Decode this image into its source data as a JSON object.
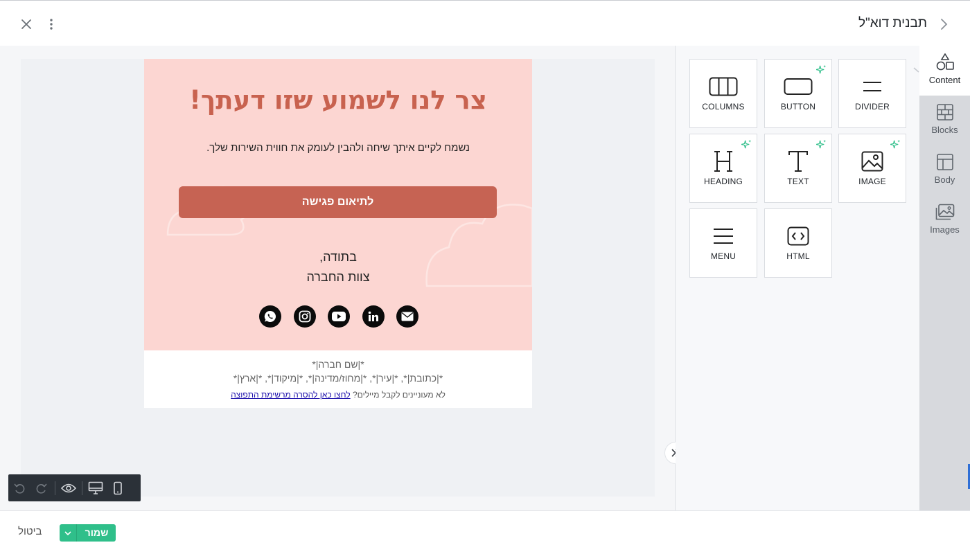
{
  "header": {
    "title": "תבנית דוא\"ל"
  },
  "email": {
    "headline": "צר לנו לשמוע שזו דעתך!",
    "subtext": "נשמח לקיים איתך שיחה ולהבין לעומק את חווית השירות שלך.",
    "cta_label": "לתיאום פגישה",
    "signature_line1": "בתודה,",
    "signature_line2": "צוות החברה",
    "social_icons": [
      "whatsapp-icon",
      "instagram-icon",
      "youtube-icon",
      "linkedin-icon",
      "email-icon"
    ],
    "footer_company": "*|שם חברה|*",
    "footer_address": "*|כתובת|*, *|עיר|*, *|מחוז/מדינה|*, *|מיקוד|*, *|ארץ|*",
    "footer_unsub_text": "לא מעוניינים לקבל מיילים?",
    "footer_unsub_link": "לחצו כאן להסרה מרשימת התפוצה"
  },
  "content_panel": {
    "tiles": [
      {
        "label": "COLUMNS",
        "icon": "columns-icon"
      },
      {
        "label": "BUTTON",
        "icon": "button-icon",
        "ai": true
      },
      {
        "label": "DIVIDER",
        "icon": "divider-icon"
      },
      {
        "label": "HEADING",
        "icon": "heading-icon",
        "ai": true
      },
      {
        "label": "TEXT",
        "icon": "text-icon",
        "ai": true
      },
      {
        "label": "IMAGE",
        "icon": "image-icon",
        "ai": true
      },
      {
        "label": "MENU",
        "icon": "menu-icon"
      },
      {
        "label": "HTML",
        "icon": "html-icon"
      }
    ]
  },
  "rail": {
    "items": [
      {
        "label": "Content",
        "icon": "shapes-icon",
        "active": true
      },
      {
        "label": "Blocks",
        "icon": "blocks-icon"
      },
      {
        "label": "Body",
        "icon": "layout-icon"
      },
      {
        "label": "Images",
        "icon": "images-icon"
      }
    ]
  },
  "footer_bar": {
    "save_label": "שמור",
    "cancel_label": "ביטול"
  },
  "colors": {
    "hero_bg": "#fcd6d2",
    "accent": "#c66353",
    "save": "#2fbf8a",
    "ai_sparkle": "#2fbf8a"
  }
}
